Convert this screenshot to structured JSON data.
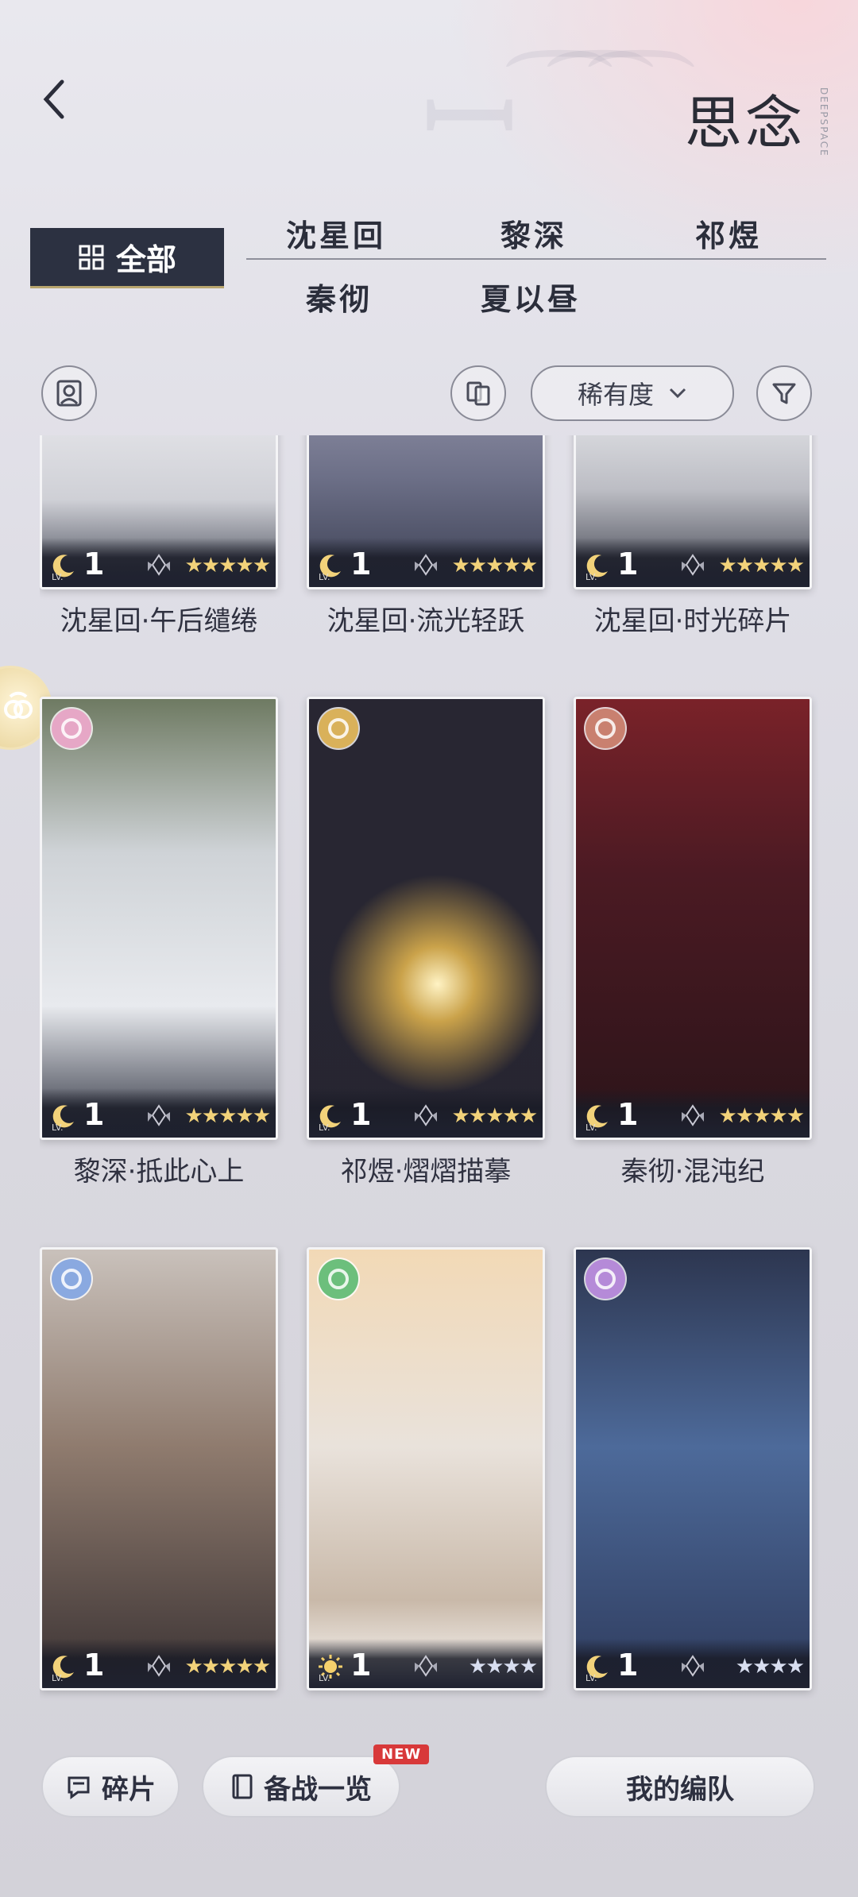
{
  "header": {
    "title": "思念",
    "back_icon": "chevron-left-icon",
    "brand_vertical": "DEEPSPACE"
  },
  "tabs": {
    "all_label": "全部",
    "characters": [
      "沈星回",
      "黎深",
      "祁煜",
      "秦彻",
      "夏以昼"
    ]
  },
  "toolbar": {
    "sort_label": "稀有度",
    "sort_icon": "chevron-down-icon",
    "filter_icon": "filter-icon",
    "left_icon": "portrait-icon",
    "swap_icon": "card-swap-icon"
  },
  "cards": [
    {
      "name": "沈星回·午后缱绻",
      "level": "1",
      "lv_tag": "LV.",
      "stars": "★★★★★",
      "palette": "sweater"
    },
    {
      "name": "沈星回·流光轻跃",
      "level": "1",
      "lv_tag": "LV.",
      "stars": "★★★★★",
      "palette": "hoodie"
    },
    {
      "name": "沈星回·时光碎片",
      "level": "1",
      "lv_tag": "LV.",
      "stars": "★★★★★",
      "palette": "jacket"
    },
    {
      "name": "黎深·抵此心上",
      "level": "1",
      "lv_tag": "LV.",
      "stars": "★★★★★",
      "badge": "#e6a7c6"
    },
    {
      "name": "祁煜·熠熠描摹",
      "level": "1",
      "lv_tag": "LV.",
      "stars": "★★★★★",
      "badge": "#d9b15a"
    },
    {
      "name": "秦彻·混沌纪",
      "level": "1",
      "lv_tag": "LV.",
      "stars": "★★★★★",
      "badge": "#c9806f"
    },
    {
      "name": "",
      "level": "1",
      "lv_tag": "LV.",
      "stars": "★★★★★",
      "badge": "#8aa9e0"
    },
    {
      "name": "",
      "level": "1",
      "lv_tag": "LV.",
      "stars": "★★★★",
      "badge": "#6cbf7c"
    },
    {
      "name": "",
      "level": "1",
      "lv_tag": "LV.",
      "stars": "★★★★",
      "badge": "#b58ad8"
    }
  ],
  "bottom": {
    "fragments_label": "碎片",
    "prep_label": "备战一览",
    "new_badge": "NEW",
    "team_label": "我的编队"
  },
  "colors": {
    "accent_dark": "#2c3141",
    "gold": "#d9b15a"
  }
}
